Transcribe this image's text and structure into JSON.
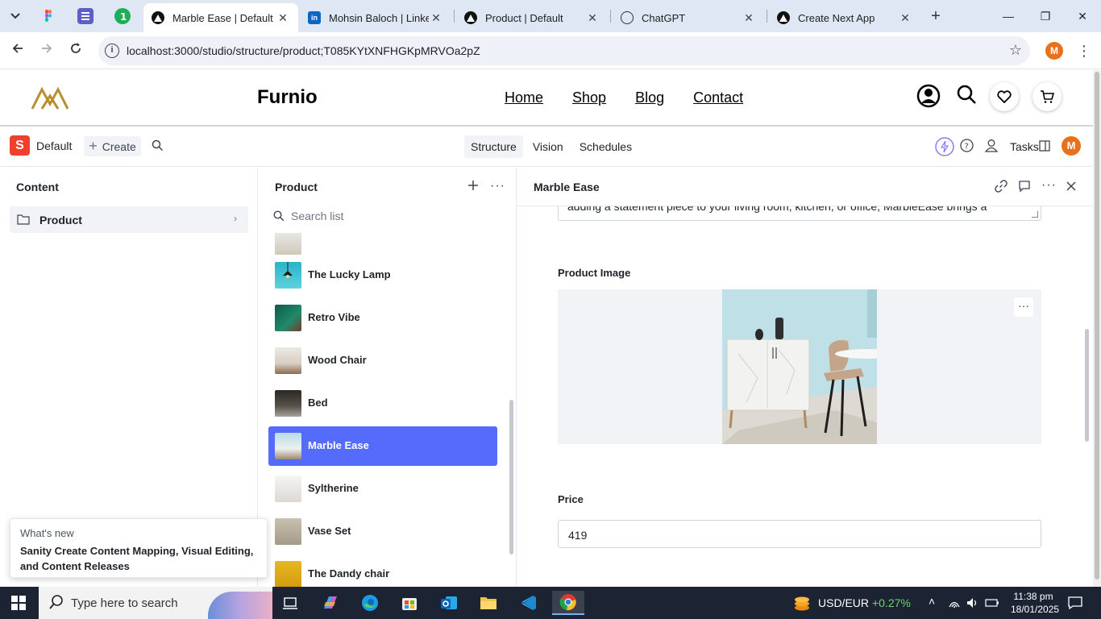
{
  "browser": {
    "tabs": [
      {
        "title": "Marble Ease | Default",
        "icon": "vercel-icon"
      },
      {
        "title": "Mohsin Baloch | Linked",
        "icon": "linkedin-icon"
      },
      {
        "title": "Product | Default",
        "icon": "vercel-icon"
      },
      {
        "title": "ChatGPT",
        "icon": "chatgpt-icon"
      },
      {
        "title": "Create Next App",
        "icon": "vercel-icon"
      }
    ],
    "url": "localhost:3000/studio/structure/product;T085KYtXNFHGKpMRVOa2pZ",
    "profile_initial": "M"
  },
  "site": {
    "brand": "Furnio",
    "nav": [
      "Home",
      "Shop",
      "Blog",
      "Contact"
    ],
    "accent": "#b88e2f"
  },
  "studio": {
    "workspace": "Default",
    "create_label": "Create",
    "tools": [
      "Structure",
      "Vision",
      "Schedules"
    ],
    "tasks_label": "Tasks",
    "avatar_initial": "M",
    "accent": "#556bfc"
  },
  "content_pane": {
    "title": "Content",
    "items": [
      "Product"
    ]
  },
  "list_pane": {
    "title": "Product",
    "search_placeholder": "Search list",
    "items": [
      {
        "name": "The Lucky Lamp"
      },
      {
        "name": "Retro Vibe"
      },
      {
        "name": "Wood Chair"
      },
      {
        "name": "Bed"
      },
      {
        "name": "Marble Ease",
        "selected": true
      },
      {
        "name": "Syltherine"
      },
      {
        "name": "Vase Set"
      },
      {
        "name": "The Dandy chair"
      }
    ]
  },
  "document": {
    "title": "Marble Ease",
    "description_visible_line": "adding a statement piece to your living room, kitchen, or office, MarbleEase brings a",
    "image_label": "Product Image",
    "price_label": "Price",
    "price_value": "419"
  },
  "toast": {
    "kicker": "What's new",
    "title": "Sanity Create Content Mapping, Visual Editing, and Content Releases"
  },
  "taskbar": {
    "search_placeholder": "Type here to search",
    "ticker_label": "USD/EUR",
    "ticker_change": "+0.27%",
    "time": "11:38 pm",
    "date": "18/01/2025"
  }
}
